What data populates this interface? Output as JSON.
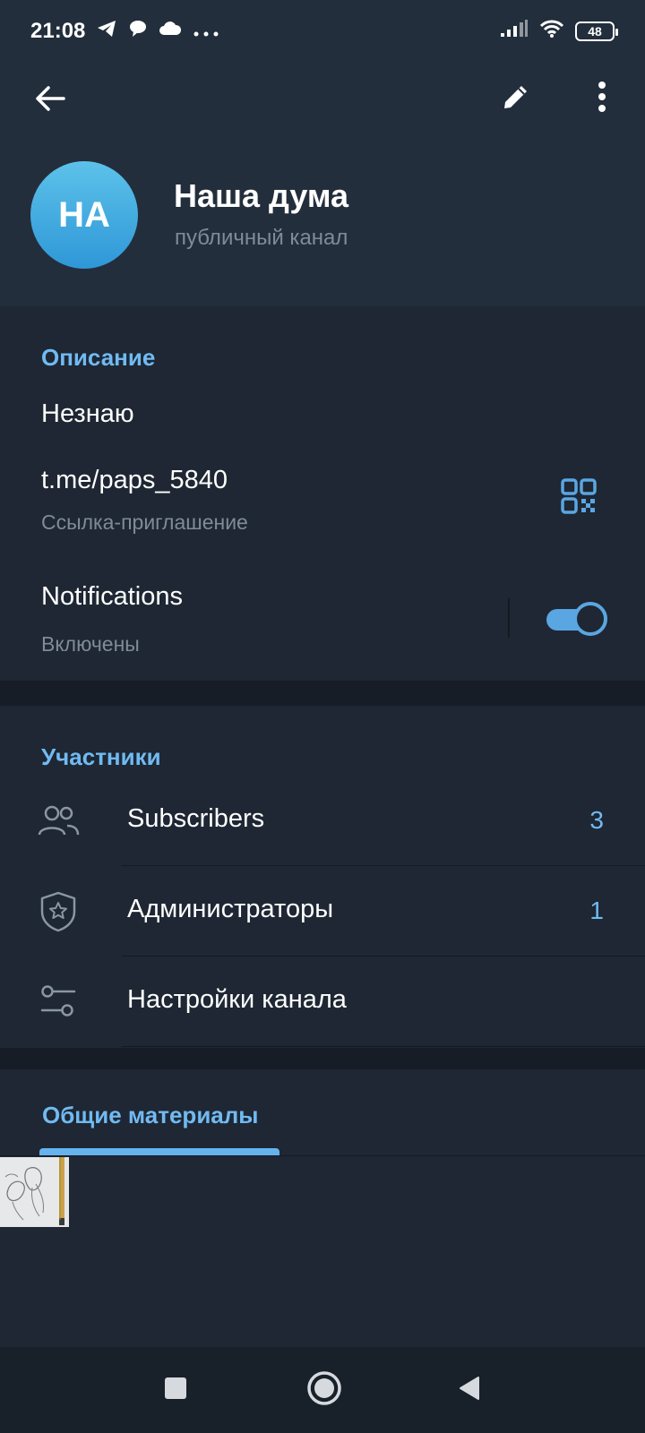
{
  "status_bar": {
    "time": "21:08",
    "icons": [
      "telegram-icon",
      "chat-icon",
      "cloud-icon",
      "more-dots-icon"
    ],
    "battery": "48"
  },
  "toolbar": {
    "back_icon": "arrow-left-icon",
    "edit_icon": "pencil-icon",
    "menu_icon": "more-vertical-icon"
  },
  "profile": {
    "avatar_initials": "НА",
    "name": "Наша дума",
    "type": "публичный канал"
  },
  "info": {
    "title": "Описание",
    "description": "Незнаю",
    "link": "t.me/paps_5840",
    "link_label": "Ссылка-приглашение",
    "notifications_label": "Notifications",
    "notifications_status": "Включены",
    "notifications_enabled": true
  },
  "members": {
    "title": "Участники",
    "items": [
      {
        "label": "Subscribers",
        "count": "3",
        "icon": "users-icon"
      },
      {
        "label": "Администраторы",
        "count": "1",
        "icon": "shield-star-icon"
      },
      {
        "label": "Настройки канала",
        "count": "",
        "icon": "sliders-icon"
      }
    ]
  },
  "shared": {
    "tab_label": "Общие материалы"
  },
  "colors": {
    "accent": "#71baf2",
    "background": "#1e2733",
    "header": "#232e3c"
  }
}
